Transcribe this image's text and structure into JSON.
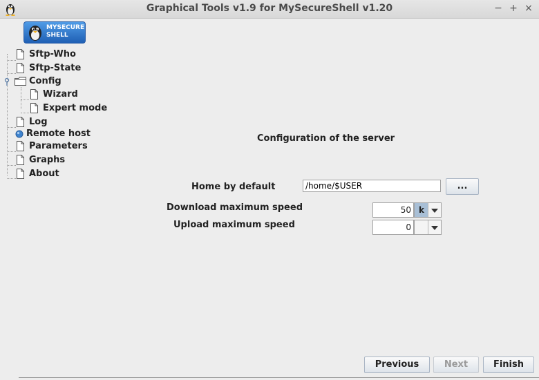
{
  "window": {
    "title": "Graphical Tools v1.9 for MySecureShell v1.20",
    "minimize": "−",
    "maximize": "+",
    "close": "×"
  },
  "logo": {
    "text": "MYSECURE\nSHELL"
  },
  "tree": {
    "items": [
      {
        "label": "Sftp-Who"
      },
      {
        "label": "Sftp-State"
      },
      {
        "label": "Config"
      },
      {
        "label": "Wizard"
      },
      {
        "label": "Expert mode"
      },
      {
        "label": "Log"
      },
      {
        "label": "Remote host"
      },
      {
        "label": "Parameters"
      },
      {
        "label": "Graphs"
      },
      {
        "label": "About"
      }
    ]
  },
  "main": {
    "heading": "Configuration of the server",
    "home_label": "Home by default",
    "home_value": "/home/$USER",
    "browse_label": "...",
    "download_label": "Download maximum speed",
    "download_value": "50",
    "download_unit": "k",
    "upload_label": "Upload maximum speed",
    "upload_value": "0",
    "upload_unit": ""
  },
  "footer": {
    "previous": "Previous",
    "next": "Next",
    "finish": "Finish"
  },
  "colors": {
    "logo_blue": "#1f5fb4",
    "selection": "#a8bfd6"
  }
}
